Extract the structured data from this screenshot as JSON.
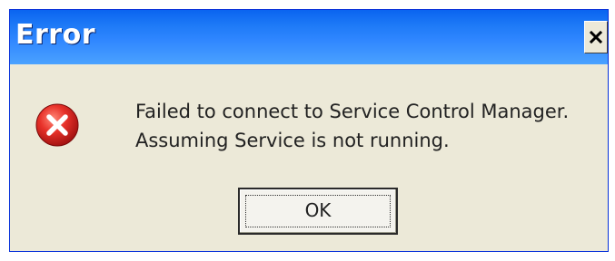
{
  "window": {
    "title": "Error",
    "close_icon": "close-icon"
  },
  "dialog": {
    "icon": "error-icon",
    "message_line1": "Failed to connect to Service Control Manager.",
    "message_line2": "Assuming Service is not running.",
    "ok_label": "OK"
  },
  "colors": {
    "titlebar": "#2f86ff",
    "body": "#ece9d8",
    "error_red": "#e02020"
  }
}
